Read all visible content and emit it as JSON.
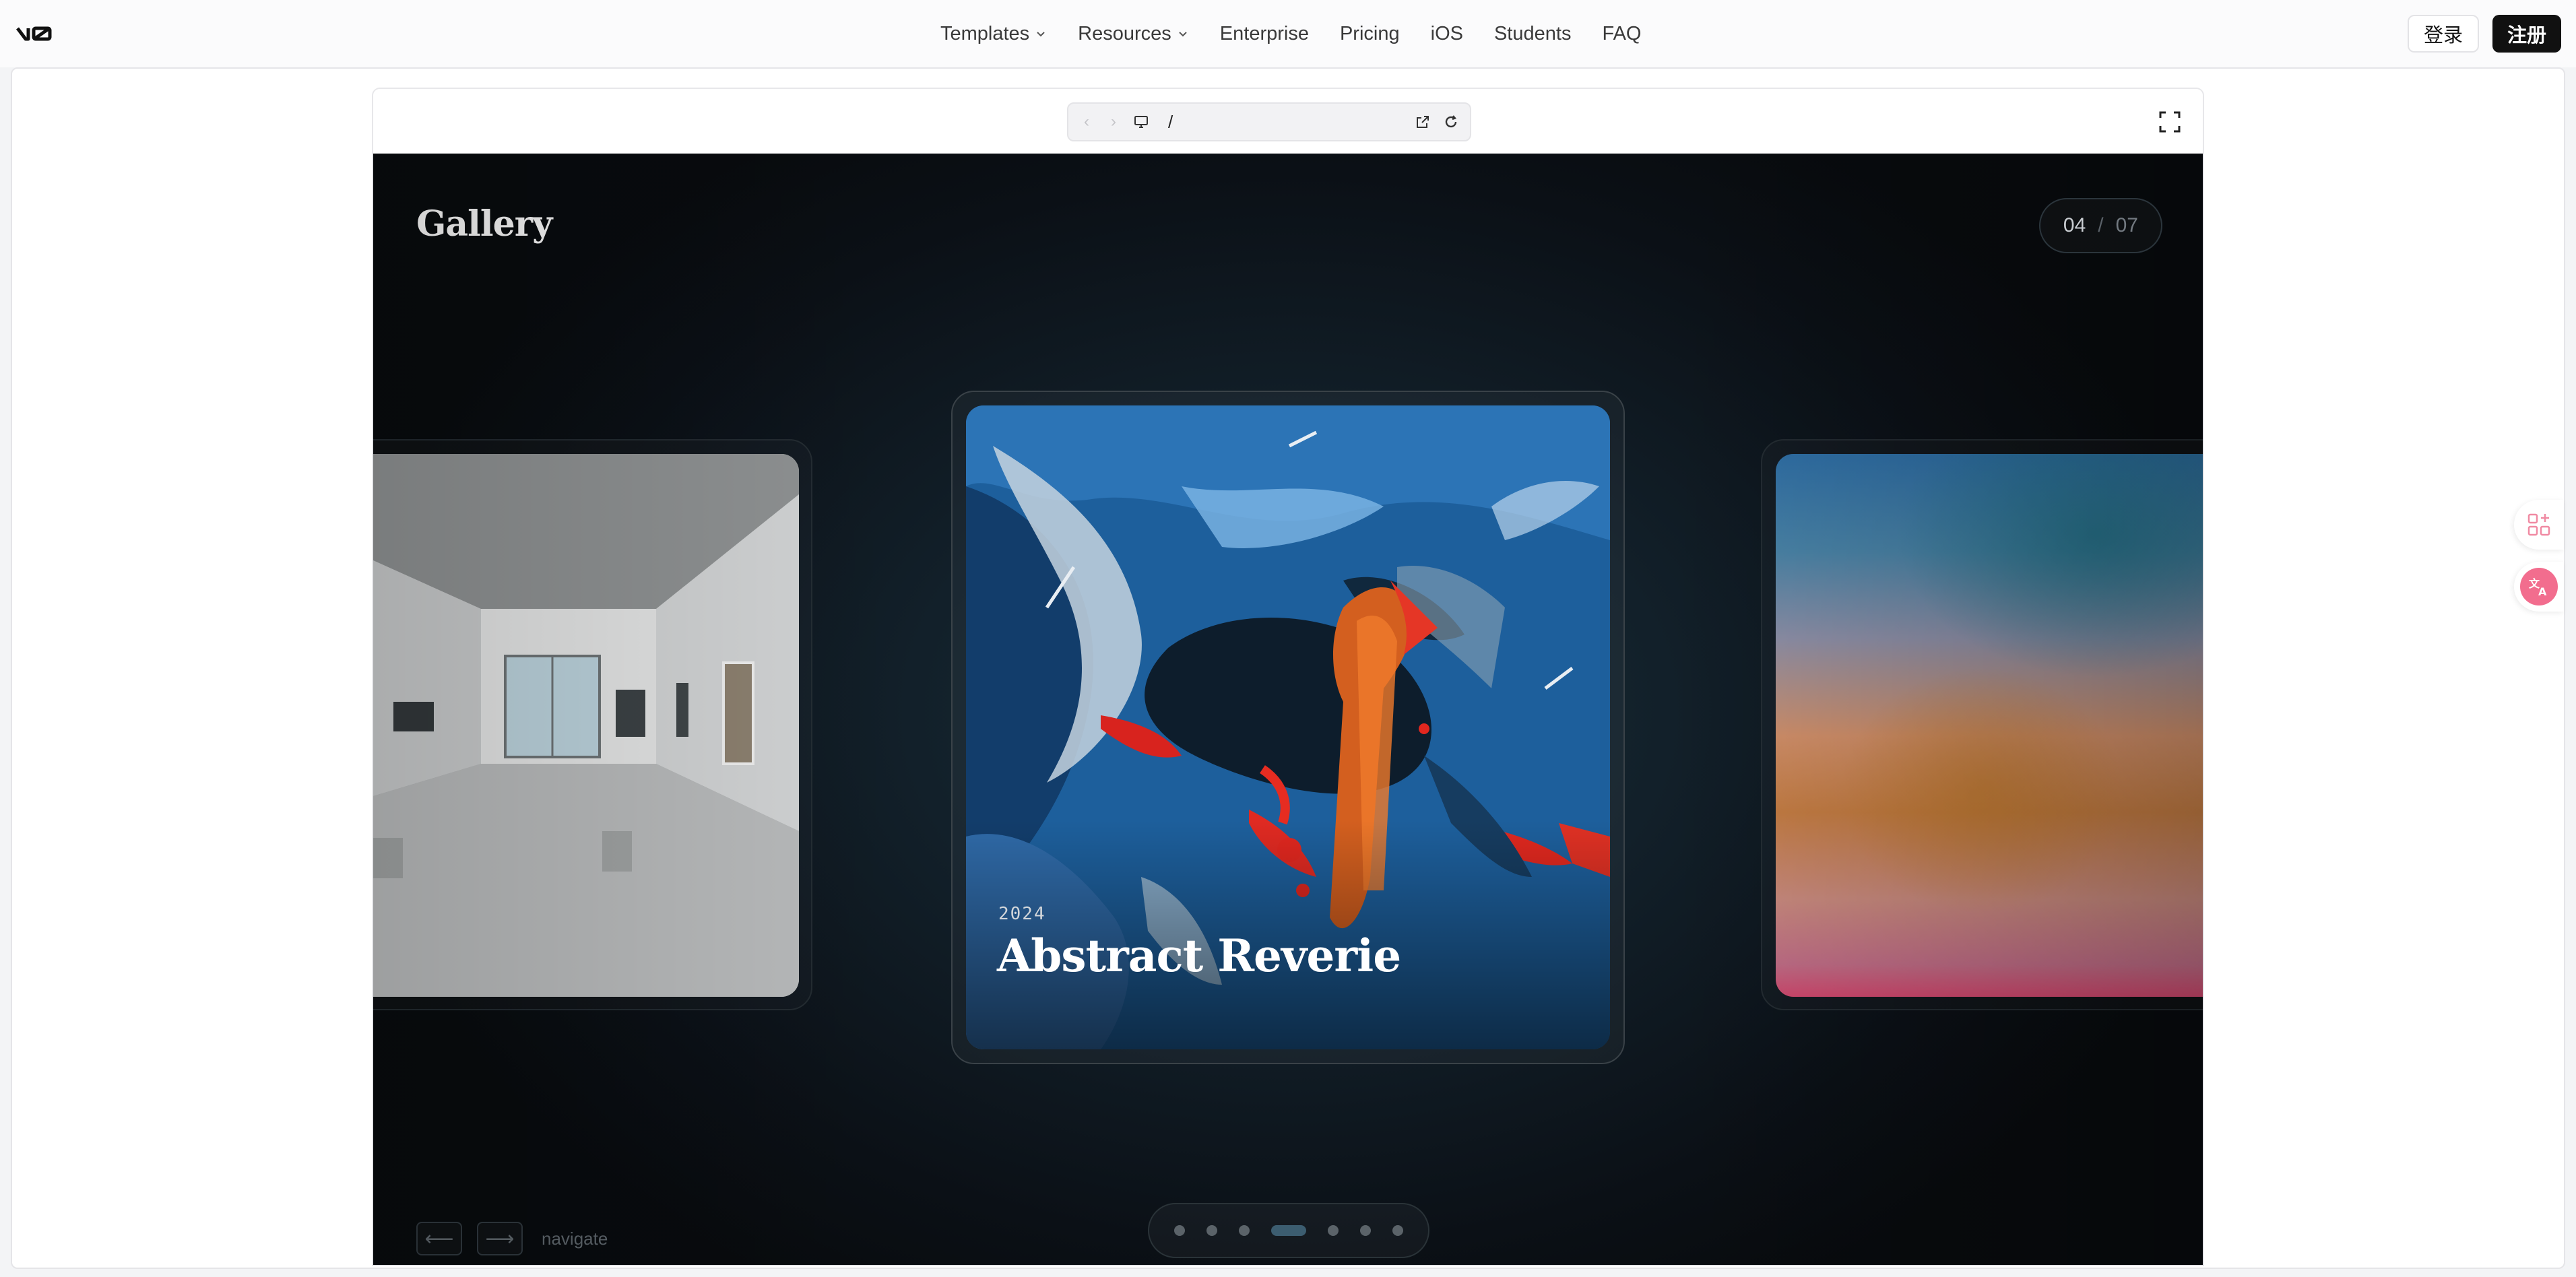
{
  "nav": {
    "links": [
      {
        "label": "Templates",
        "dropdown": true
      },
      {
        "label": "Resources",
        "dropdown": true
      },
      {
        "label": "Enterprise",
        "dropdown": false
      },
      {
        "label": "Pricing",
        "dropdown": false
      },
      {
        "label": "iOS",
        "dropdown": false
      },
      {
        "label": "Students",
        "dropdown": false
      },
      {
        "label": "FAQ",
        "dropdown": false
      }
    ],
    "login_label": "登录",
    "signup_label": "注册"
  },
  "browser": {
    "url_path": "/"
  },
  "gallery": {
    "title": "Gallery",
    "counter_current": "04",
    "counter_separator": "/",
    "counter_total": "07",
    "active_card": {
      "year": "2024",
      "title": "Abstract Reverie"
    },
    "nav_hint": "navigate",
    "prev_arrow": "⟵",
    "next_arrow": "⟶",
    "dots_total": 7,
    "dots_active_index": 3
  },
  "colors": {
    "signup_bg": "#111111",
    "stage_bg": "#0b1016",
    "active_dot": "#3c5d70",
    "translate_badge": "#f26d8e"
  }
}
